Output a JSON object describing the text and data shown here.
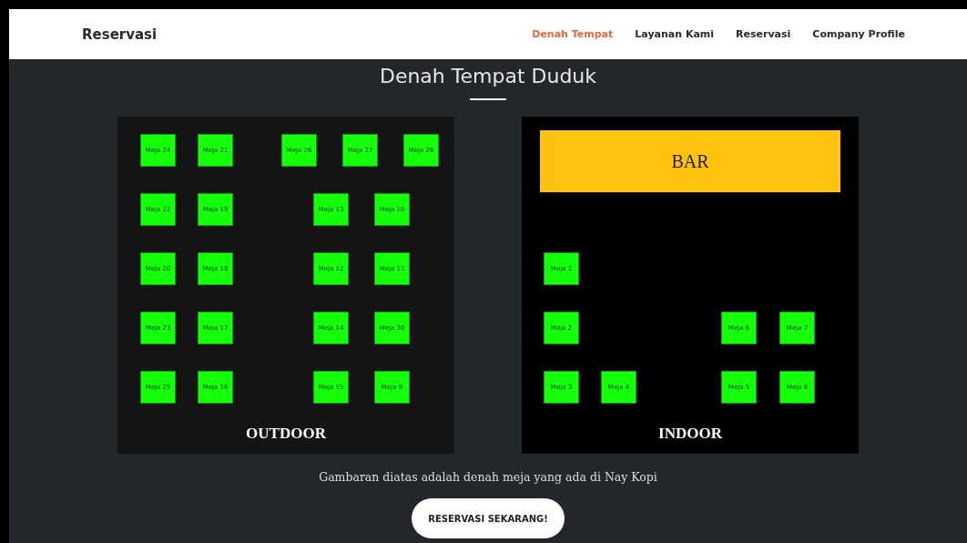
{
  "navbar": {
    "brand": "Reservasi",
    "links": [
      {
        "label": "Denah Tempat",
        "selected": true
      },
      {
        "label": "Layanan Kami",
        "selected": false
      },
      {
        "label": "Reservasi",
        "selected": false
      },
      {
        "label": "Company Profile",
        "selected": false
      }
    ]
  },
  "heading": "Denah Tempat Duduk",
  "areas": [
    {
      "kind": "outdoor",
      "name": "OUTDOOR",
      "rows": [
        {
          "left": [
            "Meja 24",
            "Meja 21"
          ],
          "right": [
            "Meja 26",
            "Meja 27",
            "Meja 28"
          ]
        },
        {
          "left": [
            "Meja 22",
            "Meja 19"
          ],
          "right": [
            "Meja 13",
            "Meja 10"
          ]
        },
        {
          "left": [
            "Meja 20",
            "Meja 18"
          ],
          "right": [
            "Meja 12",
            "Meja 11"
          ]
        },
        {
          "left": [
            "Meja 23",
            "Meja 17"
          ],
          "right": [
            "Meja 14",
            "Meja 30"
          ]
        },
        {
          "left": [
            "Meja 25",
            "Meja 16"
          ],
          "right": [
            "Meja 15",
            "Meja 9"
          ]
        }
      ]
    },
    {
      "kind": "indoor",
      "name": "INDOOR",
      "bar": "BAR",
      "rows": [
        {
          "left": [
            "Meja 1"
          ]
        },
        {
          "left": [
            "Meja 2"
          ],
          "right": [
            "Meja 6",
            "Meja 7"
          ]
        },
        {
          "left": [
            "Meja 3",
            "Meja 4"
          ],
          "right": [
            "Meja 5",
            "Meja 8"
          ]
        }
      ]
    }
  ],
  "caption": "Gambaran diatas adalah denah meja yang ada di Nay Kopi",
  "cta": "RESERVASI SEKARANG!"
}
